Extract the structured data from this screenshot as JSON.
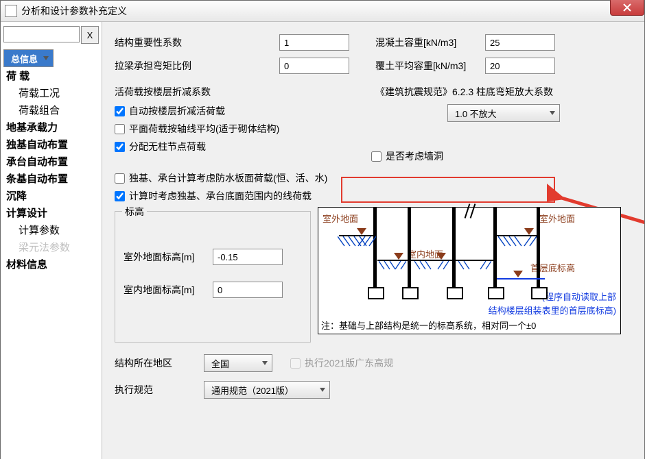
{
  "window": {
    "title": "分析和设计参数补充定义"
  },
  "sidebar": {
    "search_placeholder": "",
    "xbtn": "X",
    "items": [
      {
        "label": "总信息",
        "sel": true,
        "bold": true
      },
      {
        "label": "荷  载",
        "bold": true
      },
      {
        "label": "荷载工况",
        "sub": true
      },
      {
        "label": "荷载组合",
        "sub": true
      },
      {
        "label": "地基承载力",
        "bold": true
      },
      {
        "label": "独基自动布置",
        "bold": true
      },
      {
        "label": "承台自动布置",
        "bold": true
      },
      {
        "label": "条基自动布置",
        "bold": true
      },
      {
        "label": "沉降",
        "bold": true
      },
      {
        "label": "计算设计",
        "bold": true
      },
      {
        "label": "计算参数",
        "sub": true
      },
      {
        "label": "梁元法参数",
        "subgrey": true
      },
      {
        "label": "材料信息",
        "bold": true
      }
    ]
  },
  "fields": {
    "importance_label": "结构重要性系数",
    "importance_value": "1",
    "concrete_label": "混凝土容重[kN/m3]",
    "concrete_value": "25",
    "beam_ratio_label": "拉梁承担弯矩比例",
    "beam_ratio_value": "0",
    "soil_label": "覆土平均容重[kN/m3]",
    "soil_value": "20",
    "live_section": "活荷载按楼层折减系数",
    "seismic_note": "《建筑抗震规范》6.2.3 柱底弯矩放大系数",
    "magnify_value": "1.0   不放大",
    "chk_auto": "自动按楼层折减活荷载",
    "chk_plane": "平面荷载按轴线平均(适于砌体结构)",
    "chk_distribute": "分配无柱节点荷载",
    "chk_hole": "是否考虑墙洞",
    "chk_water": "独基、承台计算考虑防水板面荷载(恒、活、水)",
    "chk_line": "计算时考虑独基、承台底面范围内的线荷载",
    "elev_group": "标高",
    "outdoor_label": "室外地面标高[m]",
    "outdoor_value": "-0.15",
    "indoor_label": "室内地面标高[m]",
    "indoor_value": "0",
    "region_label": "结构所在地区",
    "region_value": "全国",
    "gd_label": "执行2021版广东高规",
    "code_label": "执行规范",
    "code_value": "通用规范（2021版）"
  },
  "diagram": {
    "outdoor": "室外地面",
    "indoor": "室内地面",
    "first": "首层底标高",
    "note1": "(程序自动读取上部",
    "note2": "结构楼层组装表里的首层底标高)",
    "note3": "注：基础与上部结构是统一的标高系统，相对同一个±0"
  }
}
